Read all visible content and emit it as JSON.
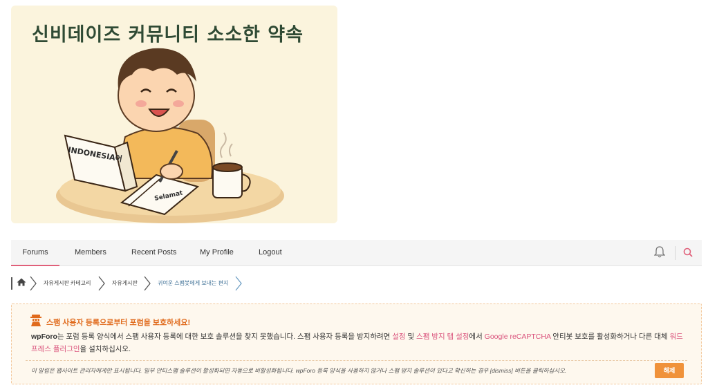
{
  "banner": {
    "title": "신비데이즈 커뮤니티 소소한 약속",
    "book_text": "INDONESIA어",
    "notebook_text": "Selamat"
  },
  "nav": {
    "items": [
      {
        "label": "Forums",
        "active": true
      },
      {
        "label": "Members"
      },
      {
        "label": "Recent Posts"
      },
      {
        "label": "My Profile"
      },
      {
        "label": "Logout"
      }
    ],
    "icons": [
      "bell-icon",
      "search-icon"
    ],
    "accent": "#e0607a"
  },
  "breadcrumb": {
    "home_icon": "home-icon",
    "items": [
      "자유게시판 카테고리",
      "자유게시판",
      "귀여운 스팸봇에게 보내는 편지"
    ]
  },
  "notice": {
    "icon": "spam-bot-icon",
    "title": "스팸 사용자 등록으로부터 포럼을 보호하세요!",
    "body_part1": "wpForo",
    "body_part2": "는 포럼 등록 양식에서 스팸 사용자 등록에 대한 보호 솔루션을 찾지 못했습니다. 스팸 사용자 등록을 방지하려면 ",
    "link_settings": "설정",
    "body_part3": " 및 ",
    "link_spam_tab": "스팸 방지 탭 설정",
    "body_part4": "에서 ",
    "link_recaptcha": "Google reCAPTCHA",
    "body_part5": " 안티봇 보호를 활성화하거나 다른 대체 ",
    "link_plugin": "워드프레스 플러그인",
    "body_part6": "을 설치하십시오.",
    "footer": "이 알림은 웹사이트 관리자에게만 표시됩니다. 일부 안티스팸 솔루션이 활성화되면 자동으로 비활성화됩니다. wpForo 등록 양식을 사용하지 않거나 스팸 방지 솔루션이 있다고 확신하는 경우 [dismiss] 버튼을 클릭하십시오.",
    "dismiss_label": "해제",
    "colors": {
      "title": "#e06a1c",
      "link": "#d9507a",
      "button": "#f0923a"
    }
  }
}
